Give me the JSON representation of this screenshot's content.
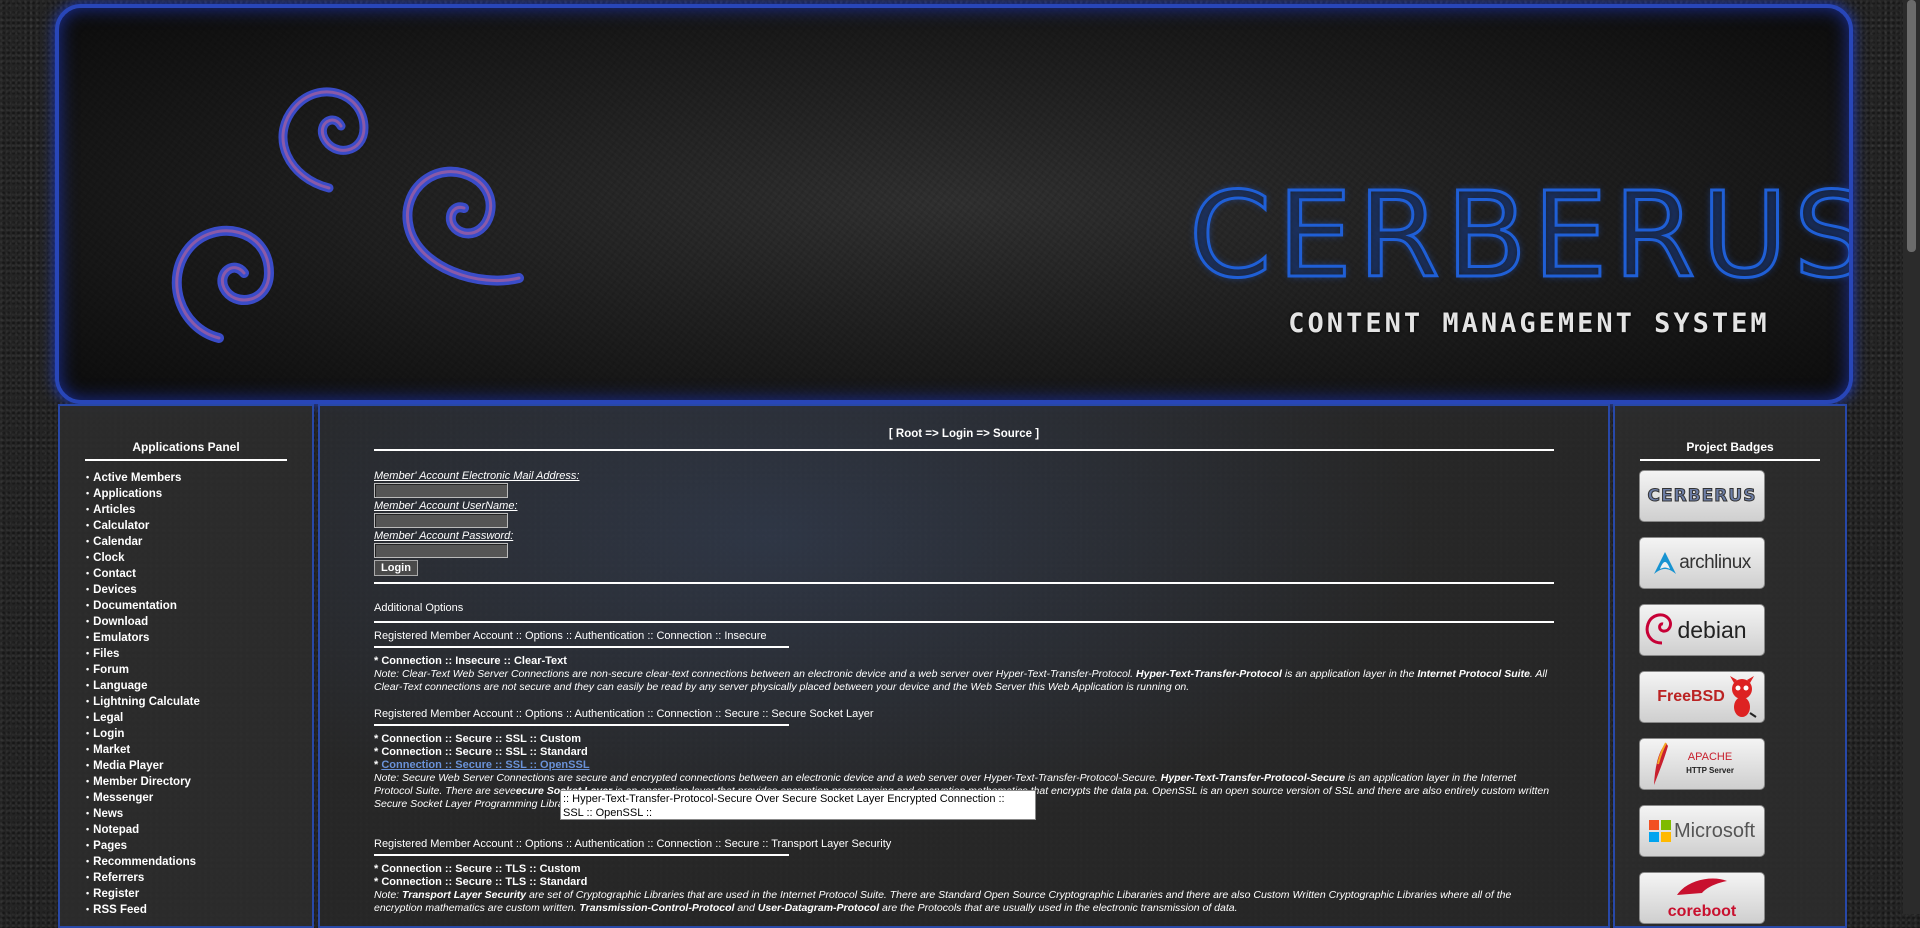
{
  "banner": {
    "title": "CERBERUS",
    "subtitle": "CONTENT MANAGEMENT SYSTEM"
  },
  "left_panel": {
    "title": "Applications Panel",
    "items": [
      {
        "label": "Active Members"
      },
      {
        "label": "Applications"
      },
      {
        "label": "Articles"
      },
      {
        "label": "Calculator"
      },
      {
        "label": "Calendar"
      },
      {
        "label": "Clock"
      },
      {
        "label": "Contact"
      },
      {
        "label": "Devices"
      },
      {
        "label": "Documentation"
      },
      {
        "label": "Download"
      },
      {
        "label": "Emulators"
      },
      {
        "label": "Files"
      },
      {
        "label": "Forum"
      },
      {
        "label": "Language"
      },
      {
        "label": "Lightning Calculate"
      },
      {
        "label": "Legal"
      },
      {
        "label": "Login"
      },
      {
        "label": "Market"
      },
      {
        "label": "Media Player"
      },
      {
        "label": "Member Directory"
      },
      {
        "label": "Messenger"
      },
      {
        "label": "News"
      },
      {
        "label": "Notepad"
      },
      {
        "label": "Pages"
      },
      {
        "label": "Recommendations"
      },
      {
        "label": "Referrers"
      },
      {
        "label": "Register"
      },
      {
        "label": "RSS Feed"
      }
    ]
  },
  "main": {
    "breadcrumb": "[ Root => Login => Source ]",
    "email_label": "Member' Account Electronic Mail Address:",
    "username_label": "Member' Account UserName:",
    "password_label": "Member' Account Password:",
    "login_button": "Login",
    "additional_options": "Additional Options",
    "insecure": {
      "heading": "Registered Member Account :: Options :: Authentication :: Connection :: Insecure",
      "option": "* Connection :: Insecure :: Clear-Text",
      "note_a": "Note: Clear-Text Web Server Connections are non-secure clear-text connections between an electronic device and a web server over Hyper-Text-Transfer-Protocol. ",
      "note_b": "Hyper-Text-Transfer-Protocol",
      "note_c": " is an application layer in the ",
      "note_d": "Internet Protocol Suite",
      "note_e": ". All Clear-Text connections are not secure and they can easily be read by any server physically placed between your device and the Web Server this Web Application is running on."
    },
    "ssl": {
      "heading": "Registered Member Account :: Options :: Authentication :: Connection :: Secure :: Secure Socket Layer",
      "option_custom": "* Connection :: Secure :: SSL :: Custom",
      "option_standard": "* Connection :: Secure :: SSL :: Standard",
      "option_openssl_prefix": "* ",
      "option_openssl_link": "Connection :: Secure :: SSL :: OpenSSL",
      "note_a": "Note: Secure Web Server Connections are secure and encrypted connections between an electronic device and a web server over Hyper-Text-Transfer-Protocol-Secure. ",
      "note_b": "Hyper-Text-Transfer-Protocol-Secure",
      "note_c": " is an application layer in the Internet Protocol Suite. There are seve",
      "note_d": "ecure Socket Layer",
      "note_e": " is an encryption layer that provides encryption programming and encryption mathematics that encrypts the data pa",
      "note_f": ". OpenSSL is an open source version of SSL and there are also entirely custom written Secure Socket Layer Programming Libraries with cus"
    },
    "tooltip_line1": ":: Hyper-Text-Transfer-Protocol-Secure Over Secure Socket Layer Encrypted Connection ::",
    "tooltip_line2": "SSL :: OpenSSL ::",
    "tls": {
      "heading": "Registered Member Account :: Options :: Authentication :: Connection :: Secure :: Transport Layer Security",
      "option_custom": "* Connection :: Secure :: TLS :: Custom",
      "option_standard": "* Connection :: Secure :: TLS :: Standard",
      "note_a": "Note: ",
      "note_b": "Transport Layer Security",
      "note_c": " are set of Cryptographic Libraries that are used in the Internet Protocol Suite. There are Standard Open Source Cryptographic Libararies and there are also Custom Written Cryptographic Libraries where all of the encryption mathematics are custom written. ",
      "note_d": "Transmission-Control-Protocol",
      "note_e": " and ",
      "note_f": "User-Datagram-Protocol",
      "note_g": " are the Protocols that are usually used in the electronic transmission of data."
    }
  },
  "right_panel": {
    "title": "Project Badges",
    "badges": [
      {
        "name": "cerberus",
        "label": "CERBERUS"
      },
      {
        "name": "archlinux",
        "label": "archlinux"
      },
      {
        "name": "debian",
        "label": "debian"
      },
      {
        "name": "freebsd",
        "label": "FreeBSD"
      },
      {
        "name": "apache",
        "label": "APACHE",
        "sub": "HTTP Server"
      },
      {
        "name": "microsoft",
        "label": "Microsoft"
      },
      {
        "name": "coreboot",
        "label": "coreboot"
      }
    ]
  },
  "colors": {
    "accent_blue": "#2848a8",
    "link_blue": "#6a92d8",
    "banner_title_blue": "#1f5fd6"
  }
}
